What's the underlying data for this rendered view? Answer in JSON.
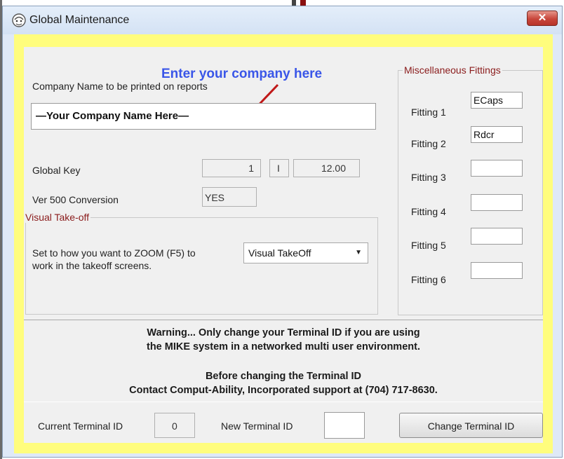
{
  "window": {
    "title": "Global Maintenance",
    "close_glyph": "✕"
  },
  "annotation": {
    "text": "Enter your company here"
  },
  "company": {
    "label": "Company Name to be printed on reports",
    "value": "—Your Company Name Here—"
  },
  "global_key": {
    "label": "Global Key",
    "value1": "1",
    "value2": "I",
    "value3": "12.00"
  },
  "ver500": {
    "label": "Ver 500 Conversion",
    "value": "YES"
  },
  "visual_takeoff": {
    "legend": "Visual Take-off",
    "description_line1": "Set to how you want to ZOOM (F5) to",
    "description_line2": "work in the takeoff screens.",
    "selected": "Visual TakeOff"
  },
  "misc_fittings": {
    "legend": "Miscellaneous Fittings",
    "items": [
      {
        "label": "Fitting 1",
        "value": "ECaps"
      },
      {
        "label": "Fitting 2",
        "value": "Rdcr"
      },
      {
        "label": "Fitting 3",
        "value": ""
      },
      {
        "label": "Fitting 4",
        "value": ""
      },
      {
        "label": "Fitting 5",
        "value": ""
      },
      {
        "label": "Fitting 6",
        "value": ""
      }
    ]
  },
  "warning": {
    "line1": "Warning... Only change your Terminal ID if you are using",
    "line2": "the MIKE system in a networked multi user environment.",
    "line3": "Before changing the Terminal ID",
    "line4": "Contact Comput-Ability, Incorporated support at (704) 717-8630."
  },
  "terminal": {
    "current_label": "Current Terminal ID",
    "current_value": "0",
    "new_label": "New Terminal ID",
    "new_value": "",
    "change_button": "Change Terminal ID"
  },
  "colors": {
    "dialog_background": "#fffd7d",
    "annotation_text": "#3a56e8",
    "arrow": "#c01818",
    "group_legend": "#8a1b1b",
    "close_button": "#c8463b"
  },
  "icons": [
    "app-icon",
    "close-icon",
    "arrow-annotation-icon",
    "dropdown-arrow-icon"
  ]
}
